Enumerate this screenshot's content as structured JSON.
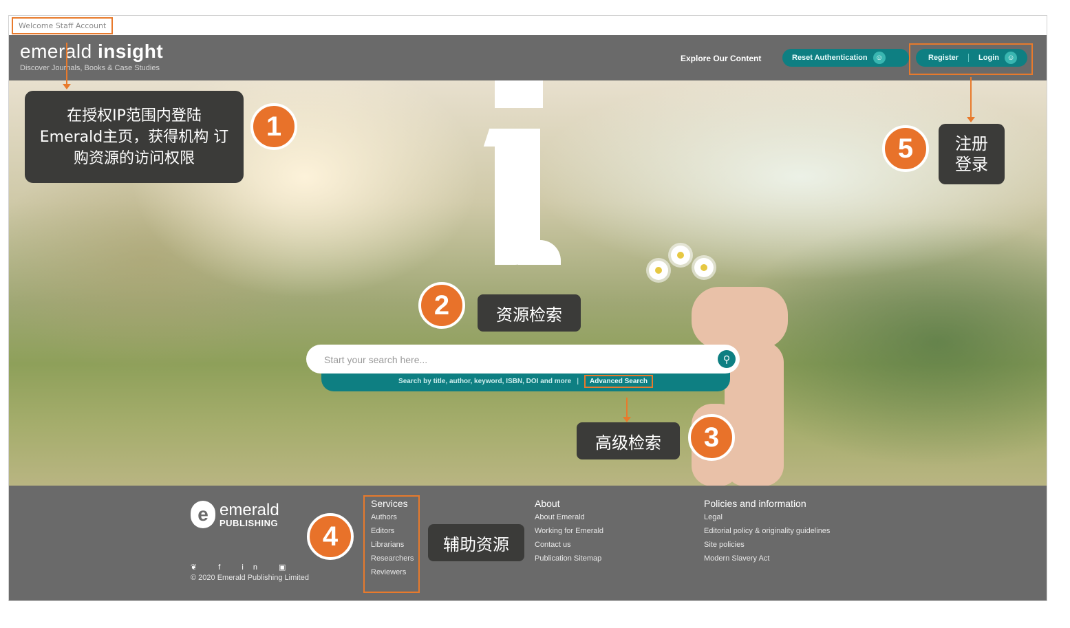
{
  "topbar": {
    "welcome": "Welcome Staff Account"
  },
  "header": {
    "brand_light": "emerald ",
    "brand_bold": "insight",
    "tagline": "Discover Journals, Books & Case Studies",
    "explore": "Explore Our Content",
    "reset_auth": "Reset Authentication",
    "register": "Register",
    "login": "Login"
  },
  "search": {
    "placeholder": "Start your search here...",
    "hint": "Search by title, author, keyword, ISBN, DOI and more",
    "separator": "|",
    "advanced": "Advanced Search"
  },
  "footer": {
    "logo_top": "emerald",
    "logo_bottom": "PUBLISHING",
    "social": "❦ f in ▣",
    "copyright": "© 2020 Emerald Publishing Limited",
    "services": {
      "title": "Services",
      "items": [
        "Authors",
        "Editors",
        "Librarians",
        "Researchers",
        "Reviewers"
      ]
    },
    "about": {
      "title": "About",
      "items": [
        "About Emerald",
        "Working for Emerald",
        "Contact us",
        "Publication Sitemap"
      ]
    },
    "policies": {
      "title": "Policies and information",
      "items": [
        "Legal",
        "Editorial policy & originality guidelines",
        "Site policies",
        "Modern Slavery Act"
      ]
    }
  },
  "annotations": {
    "a1": {
      "number": "1",
      "text": "在授权IP范围内登陆 Emerald主页，获得机构 订购资源的访问权限"
    },
    "a2": {
      "number": "2",
      "text": "资源检索"
    },
    "a3": {
      "number": "3",
      "text": "高级检索"
    },
    "a4": {
      "number": "4",
      "text": "辅助资源"
    },
    "a5": {
      "number": "5",
      "text": "注册 登录"
    }
  },
  "colors": {
    "teal": "#0e7f82",
    "header_gray": "#6a6a6a",
    "annotation_orange": "#e8722a",
    "callout_dark": "#3b3b39"
  }
}
